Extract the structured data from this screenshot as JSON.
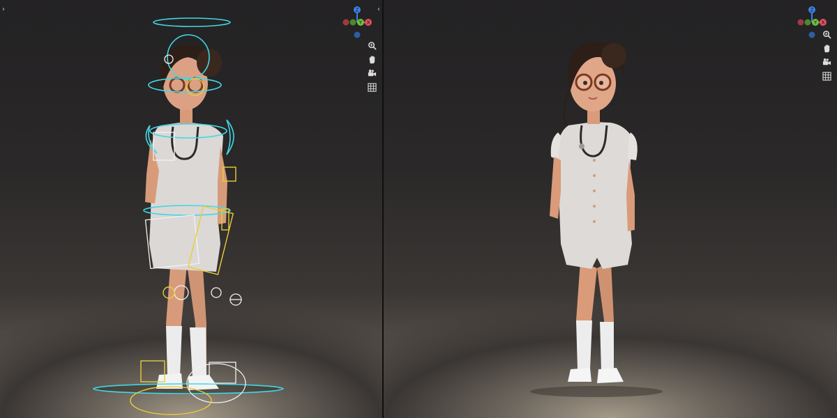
{
  "viewports": [
    {
      "id": "left",
      "mode": "pose-rig",
      "gizmo_axes": [
        "Z",
        "Y",
        "X"
      ],
      "collapse_left_icon": "chevron-right-icon",
      "collapse_right_icon": "chevron-left-icon"
    },
    {
      "id": "right",
      "mode": "rendered",
      "gizmo_axes": [
        "Z",
        "Y",
        "X"
      ]
    }
  ],
  "nav_tools": [
    "zoom-icon",
    "pan-hand-icon",
    "camera-icon",
    "grid-icon"
  ],
  "colors": {
    "axis_x": "#e0505e",
    "axis_y": "#6fbf3a",
    "axis_z": "#3d82e6",
    "rig_cyan": "#41d8e6",
    "rig_yellow": "#e8cd3a",
    "rig_white": "#f2f2f2",
    "uniform": "#d9d5d2",
    "skin": "#d89b79",
    "hair": "#2d1e18"
  },
  "character": "nurse"
}
